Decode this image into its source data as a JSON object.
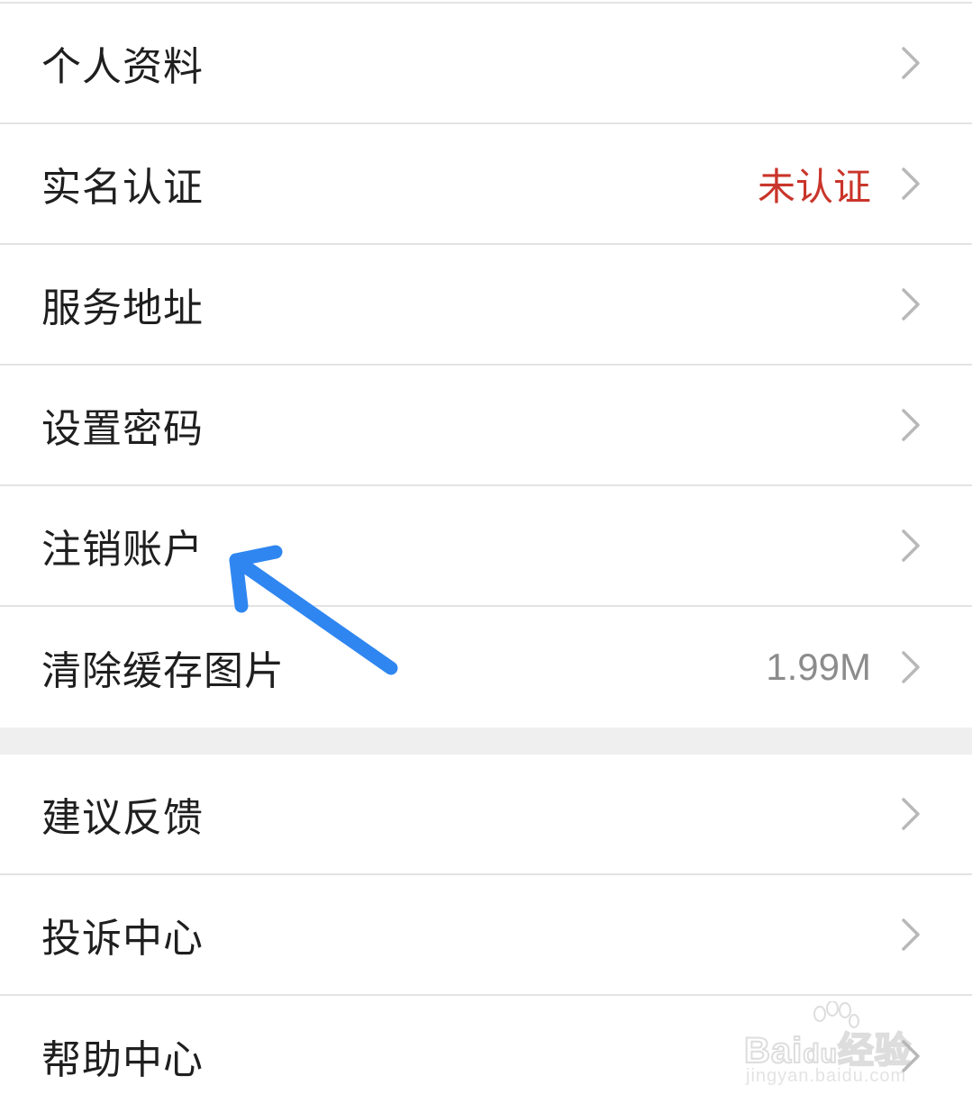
{
  "settings_list": {
    "items": [
      {
        "label": "个人资料",
        "value": ""
      },
      {
        "label": "实名认证",
        "value": "未认证"
      },
      {
        "label": "服务地址",
        "value": ""
      },
      {
        "label": "设置密码",
        "value": ""
      },
      {
        "label": "注销账户",
        "value": ""
      },
      {
        "label": "清除缓存图片",
        "value": "1.99M"
      }
    ]
  },
  "support_list": {
    "items": [
      {
        "label": "建议反馈"
      },
      {
        "label": "投诉中心"
      },
      {
        "label": "帮助中心"
      }
    ]
  },
  "annotation": {
    "type": "arrow-icon",
    "color": "#2f86f0",
    "points_to": "注销账户"
  },
  "watermark": {
    "brand": "Bai度经验",
    "url": "jingyan.baidu.com"
  },
  "colors": {
    "unverified_status": "#c9352a",
    "secondary_value": "#8c8c8c",
    "divider": "#e3e3e3",
    "section_gap": "#efefef"
  },
  "icons": {
    "row_chevron": "chevron-right-icon",
    "annotation": "arrow-icon",
    "watermark_logo": "paw-icon"
  }
}
